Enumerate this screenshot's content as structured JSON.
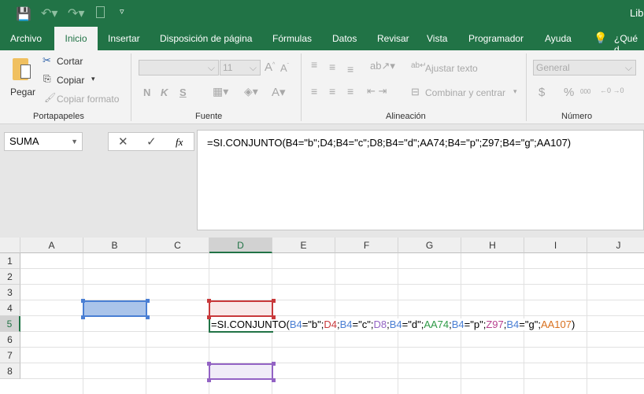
{
  "title_bar": {
    "title": "Lib"
  },
  "tabs": [
    "Archivo",
    "Inicio",
    "Insertar",
    "Disposición de página",
    "Fórmulas",
    "Datos",
    "Revisar",
    "Vista",
    "Programador",
    "Ayuda"
  ],
  "tell_me": "¿Qué d",
  "ribbon": {
    "clipboard": {
      "paste": "Pegar",
      "cut": "Cortar",
      "copy": "Copiar",
      "format_painter": "Copiar formato",
      "label": "Portapapeles"
    },
    "font": {
      "size": "11",
      "bold": "N",
      "italic": "K",
      "underline": "S",
      "label": "Fuente"
    },
    "alignment": {
      "wrap": "Ajustar texto",
      "merge": "Combinar y centrar",
      "label": "Alineación"
    },
    "number": {
      "format": "General",
      "currency": "$",
      "percent": "%",
      "thousands": "000",
      "label": "Número"
    }
  },
  "name_box": "SUMA",
  "fx": "fx",
  "formula": "=SI.CONJUNTO(B4=\"b\";D4;B4=\"c\";D8;B4=\"d\";AA74;B4=\"p\";Z97;B4=\"g\";AA107)",
  "columns": [
    "A",
    "B",
    "C",
    "D",
    "E",
    "F",
    "G",
    "H",
    "I",
    "J"
  ],
  "rows": [
    "1",
    "2",
    "3",
    "4",
    "5",
    "6",
    "7",
    "8"
  ],
  "cell_tokens": [
    {
      "t": "=SI.CONJUNTO(",
      "c": "#000000"
    },
    {
      "t": "B4",
      "c": "#4a7fd4"
    },
    {
      "t": "=\"b\";",
      "c": "#000000"
    },
    {
      "t": "D4",
      "c": "#c8393b"
    },
    {
      "t": ";",
      "c": "#000000"
    },
    {
      "t": "B4",
      "c": "#4a7fd4"
    },
    {
      "t": "=\"c\";",
      "c": "#000000"
    },
    {
      "t": "D8",
      "c": "#9363c4"
    },
    {
      "t": ";",
      "c": "#000000"
    },
    {
      "t": "B4",
      "c": "#4a7fd4"
    },
    {
      "t": "=\"d\";",
      "c": "#000000"
    },
    {
      "t": "AA74",
      "c": "#2e9a46"
    },
    {
      "t": ";",
      "c": "#000000"
    },
    {
      "t": "B4",
      "c": "#4a7fd4"
    },
    {
      "t": "=\"p\";",
      "c": "#000000"
    },
    {
      "t": "Z97",
      "c": "#b8408e"
    },
    {
      "t": ";",
      "c": "#000000"
    },
    {
      "t": "B4",
      "c": "#4a7fd4"
    },
    {
      "t": "=\"g\";",
      "c": "#000000"
    },
    {
      "t": "AA107",
      "c": "#d8701e"
    },
    {
      "t": ")",
      "c": "#000000"
    }
  ],
  "colors": {
    "brand": "#217346",
    "ref_b4": "#4a7fd4",
    "ref_d4": "#c8393b",
    "ref_d8": "#9363c4",
    "active": "#217346"
  }
}
